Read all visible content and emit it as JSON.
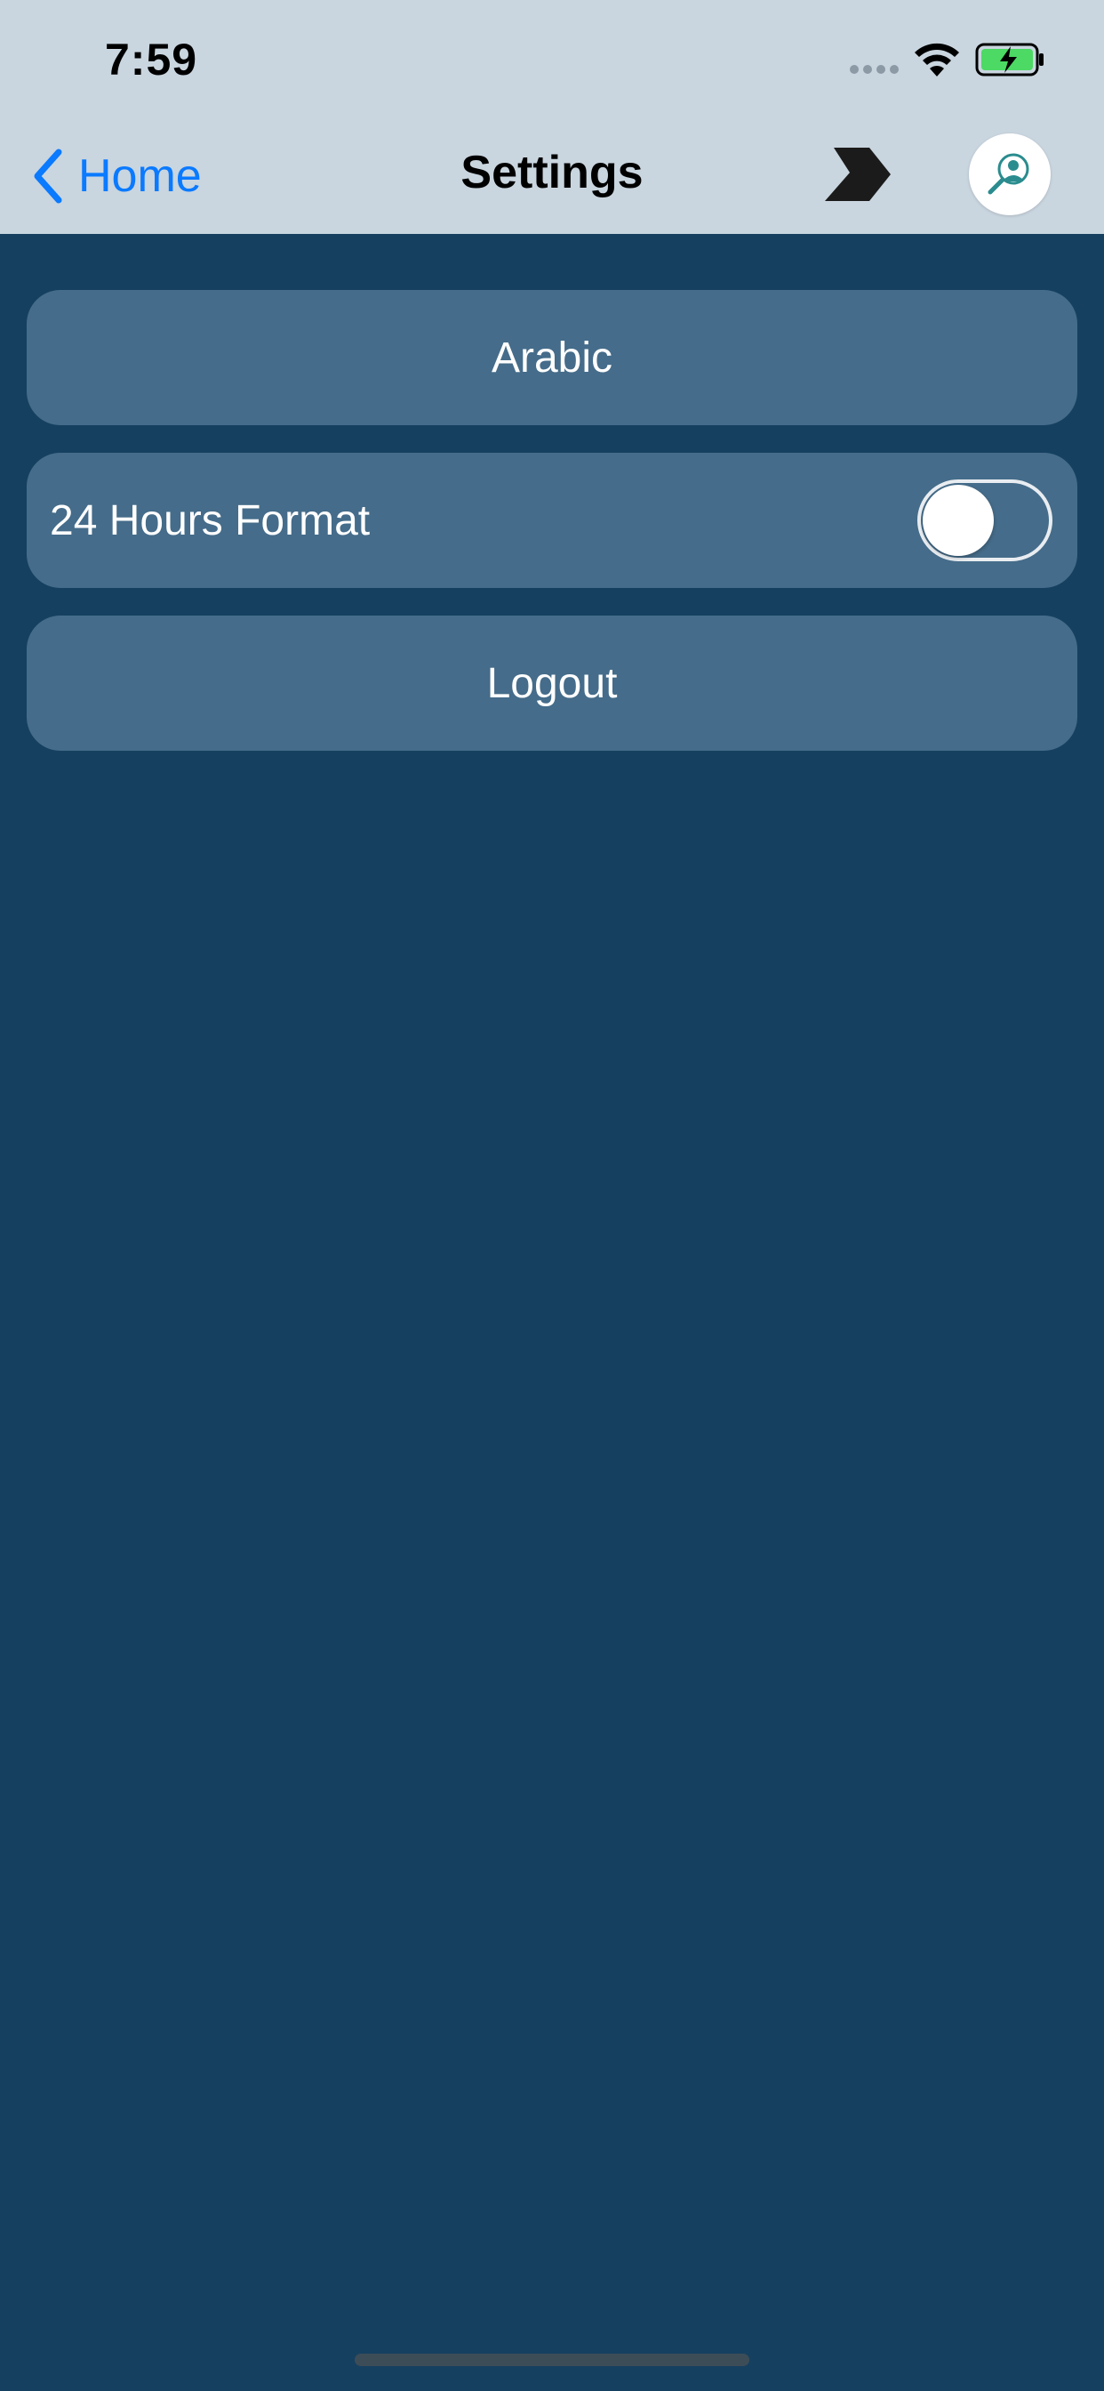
{
  "status_bar": {
    "time": "7:59"
  },
  "nav": {
    "back_label": "Home",
    "title": "Settings"
  },
  "settings": {
    "language_button": "Arabic",
    "time_format_label": "24 Hours Format",
    "time_format_enabled": false,
    "logout_button": "Logout"
  },
  "colors": {
    "background": "#164060",
    "nav_bar": "#c9d5df",
    "row": "#456c8a",
    "accent": "#0a7aff",
    "battery": "#4cd964"
  },
  "icons": {
    "back": "chevron-left-icon",
    "bookmark": "bookmark-icon",
    "avatar": "avatar-icon",
    "wifi": "wifi-icon",
    "battery": "battery-charging-icon"
  }
}
